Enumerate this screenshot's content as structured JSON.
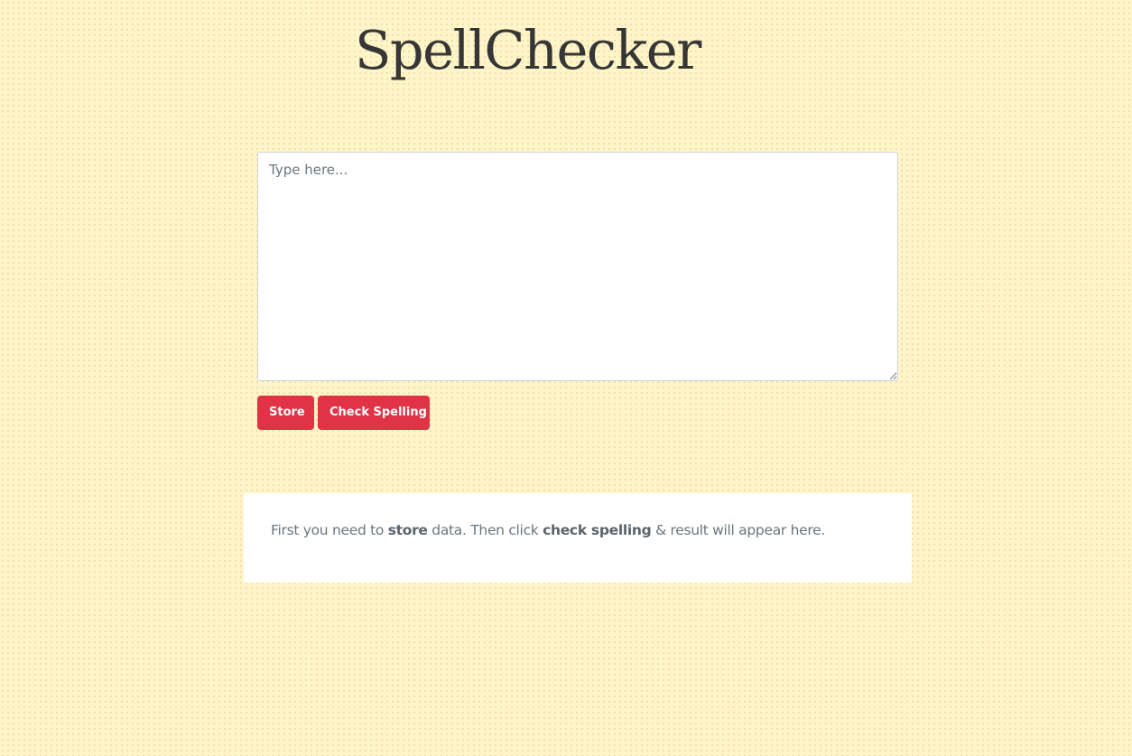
{
  "app": {
    "title": "SpellChecker"
  },
  "editor": {
    "placeholder": "Type here...",
    "value": ""
  },
  "actions": {
    "store_label": "Store",
    "check_label": "Check Spelling"
  },
  "result": {
    "part1": "First you need to ",
    "bold1": "store",
    "part2": " data. Then click ",
    "bold2": "check spelling",
    "part3": " & result will appear here."
  },
  "theme": {
    "background": "#fff5c8",
    "accent": "#e03346",
    "title_color": "#363636",
    "text_color": "#6c757d"
  }
}
